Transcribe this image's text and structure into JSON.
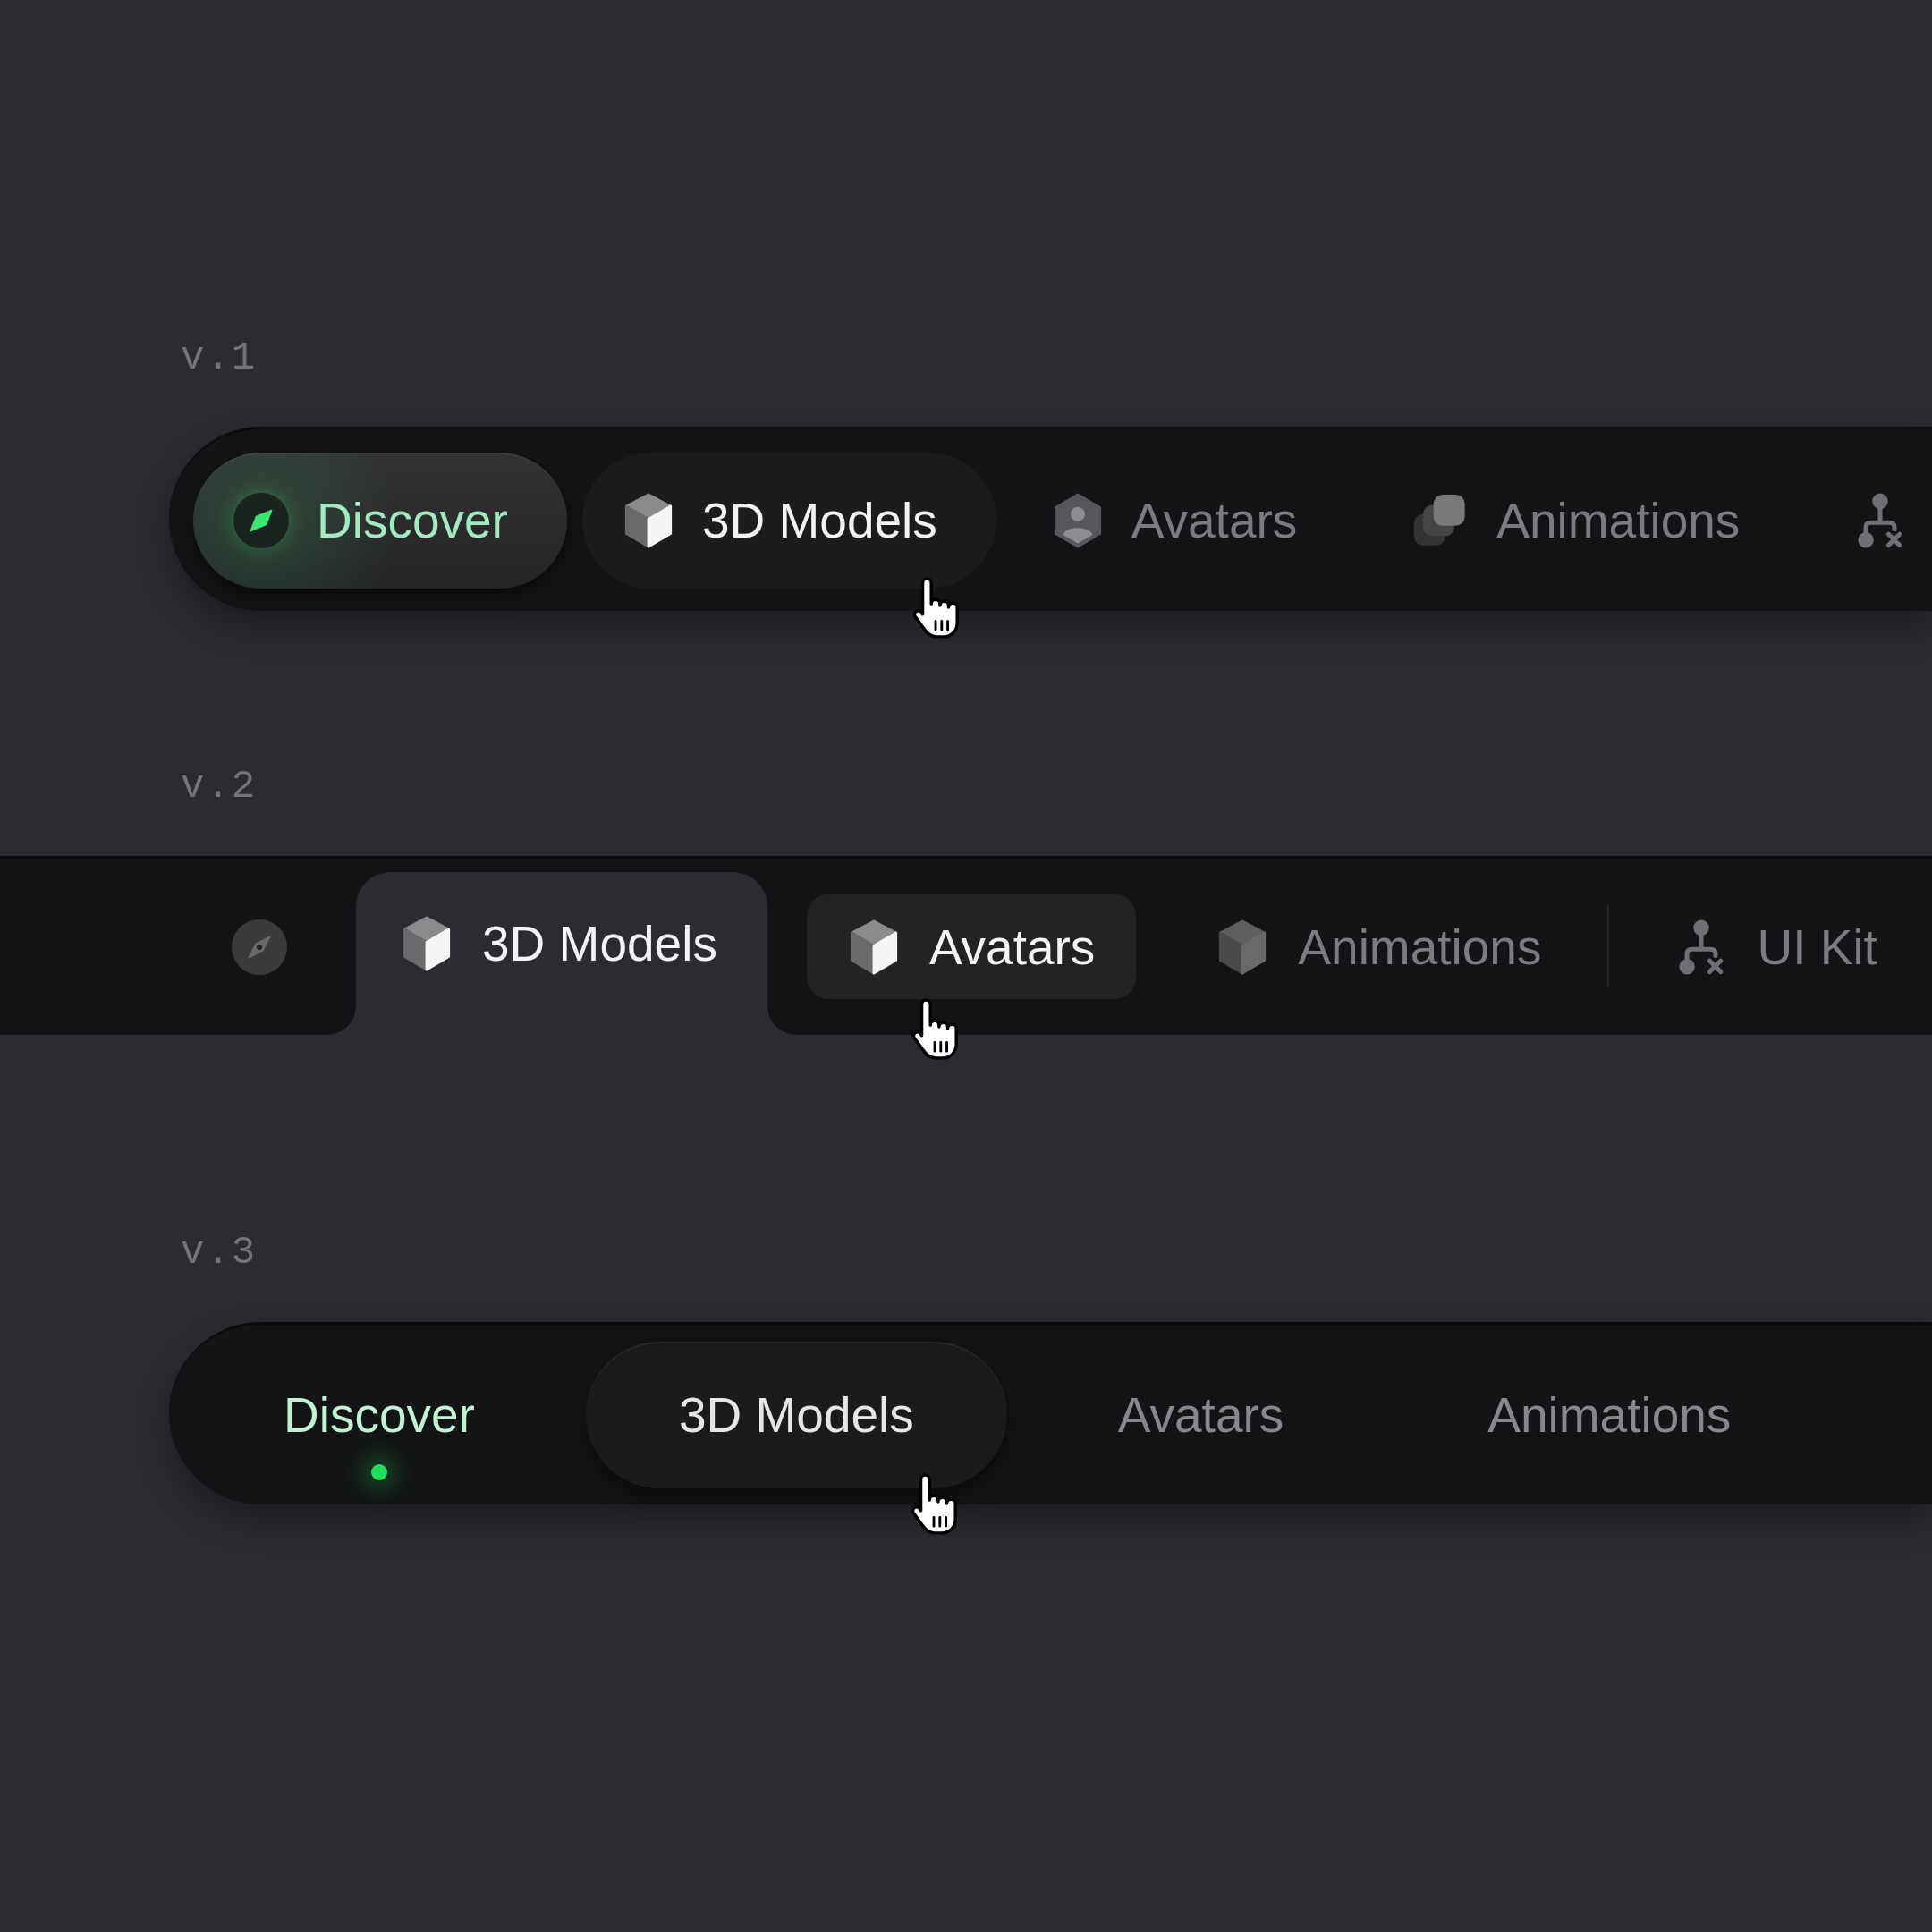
{
  "navbars": [
    {
      "title": "v.1",
      "kind": "pill",
      "tabs": [
        {
          "label": "Discover",
          "selected": true,
          "hovered": false
        },
        {
          "label": "3D Models",
          "selected": false,
          "hovered": true
        },
        {
          "label": "Avatars",
          "selected": false,
          "hovered": false
        },
        {
          "label": "Animations",
          "selected": false,
          "hovered": false
        },
        {
          "selected": false,
          "hovered": false
        }
      ]
    },
    {
      "title": "v.2",
      "kind": "folder",
      "tabs": [
        {
          "selected": false,
          "hovered": false
        },
        {
          "label": "3D Models",
          "selected": true,
          "hovered": false
        },
        {
          "label": "Avatars",
          "selected": false,
          "hovered": true
        },
        {
          "label": "Animations",
          "selected": false,
          "hovered": false
        },
        {
          "label": "UI Kit",
          "selected": false,
          "hovered": false
        }
      ]
    },
    {
      "title": "v.3",
      "kind": "dot",
      "tabs": [
        {
          "label": "Discover",
          "selected": true,
          "hovered": false
        },
        {
          "label": "3D Models",
          "selected": false,
          "hovered": true
        },
        {
          "label": "Avatars",
          "selected": false,
          "hovered": false
        },
        {
          "label": "Animations",
          "selected": false,
          "hovered": false
        }
      ]
    }
  ]
}
